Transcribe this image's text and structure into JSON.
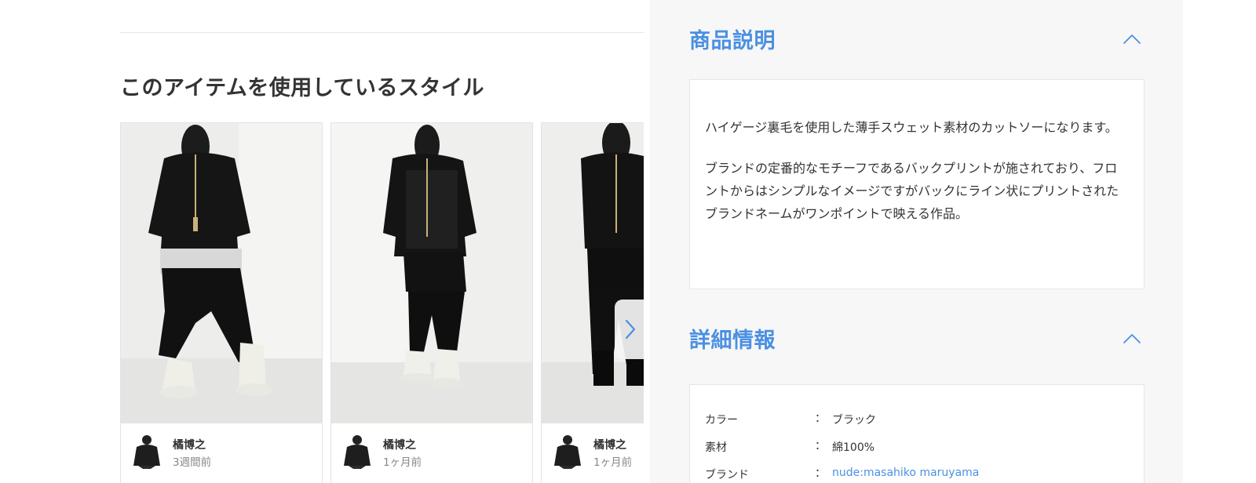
{
  "styles_section": {
    "heading": "このアイテムを使用しているスタイル",
    "cards": [
      {
        "user": "橘博之",
        "time": "3週間前"
      },
      {
        "user": "橘博之",
        "time": "1ヶ月前"
      },
      {
        "user": "橘博之",
        "time": "1ヶ月前"
      }
    ],
    "next_icon": "chevron-right-icon"
  },
  "description": {
    "title": "商品説明",
    "collapse_icon": "chevron-up-icon",
    "paragraphs": [
      "ハイゲージ裏毛を使用した薄手スウェット素材のカットソーになります。",
      "ブランドの定番的なモチーフであるバックプリントが施されており、フロントからはシンプルなイメージですがバックにライン状にプリントされたブランドネームがワンポイントで映える作品。"
    ]
  },
  "details": {
    "title": "詳細情報",
    "collapse_icon": "chevron-up-icon",
    "rows": [
      {
        "label": "カラー",
        "colon": "：",
        "value": "ブラック"
      },
      {
        "label": "素材",
        "colon": "：",
        "value": "綿100%"
      },
      {
        "label": "ブランド",
        "colon": "：",
        "value": "nude:masahiko maruyama"
      }
    ]
  },
  "colors": {
    "accent": "#4a90e2",
    "panel_bg": "#f7f7f7",
    "text": "#333333",
    "muted": "#888888"
  }
}
